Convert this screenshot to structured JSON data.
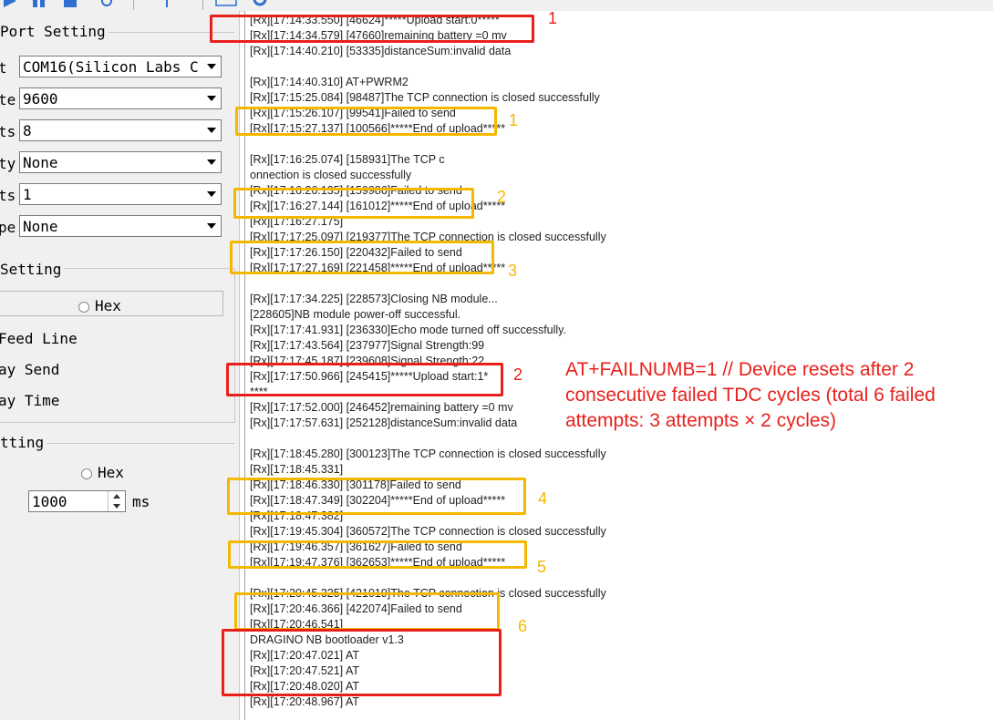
{
  "port_setting": {
    "title": "Port Setting",
    "fields": [
      {
        "label": "t",
        "value": "COM16(Silicon Labs C"
      },
      {
        "label": "te",
        "value": "9600"
      },
      {
        "label": "ts",
        "value": "8"
      },
      {
        "label": "ty",
        "value": "None"
      },
      {
        "label": "ts",
        "value": "1"
      },
      {
        "label": "pe",
        "value": "None"
      }
    ]
  },
  "receive_setting": {
    "title": " Setting",
    "hex_label": "Hex",
    "lines": [
      "Feed Line",
      "ay Send",
      "ay Time"
    ]
  },
  "send_setting": {
    "title": "tting",
    "hex_label": "Hex",
    "interval_value": "1000",
    "interval_unit": "ms"
  },
  "log_lines": [
    "[Rx][17:14:33.550] [46624]*****Upload start:0*****",
    "[Rx][17:14:34.579] [47660]remaining battery =0 mv",
    "[Rx][17:14:40.210] [53335]distanceSum:invalid data",
    "",
    "[Rx][17:14:40.310] AT+PWRM2",
    "[Rx][17:15:25.084] [98487]The TCP connection is closed successfully",
    "[Rx][17:15:26.107] [99541]Failed to send",
    "[Rx][17:15:27.137] [100566]*****End of upload*****",
    "",
    "[Rx][17:16:25.074] [158931]The TCP c",
    "onnection is closed successfully",
    "[Rx][17:16:26.135] [159986]Failed to send",
    "[Rx][17:16:27.144] [161012]*****End of upload*****",
    "[Rx][17:16:27.175]",
    "[Rx][17:17:25.097] [219377]The TCP connection is closed successfully",
    "[Rx][17:17:26.150] [220432]Failed to send",
    "[Rx][17:17:27.169] [221458]*****End of upload*****",
    "",
    "[Rx][17:17:34.225] [228573]Closing NB module...",
    "[228605]NB module power-off successful.",
    "[Rx][17:17:41.931] [236330]Echo mode turned off successfully.",
    "[Rx][17:17:43.564] [237977]Signal Strength:99",
    "[Rx][17:17:45.187] [239608]Signal Strength:22",
    "[Rx][17:17:50.966] [245415]*****Upload start:1*",
    "****",
    "[Rx][17:17:52.000] [246452]remaining battery =0 mv",
    "[Rx][17:17:57.631] [252128]distanceSum:invalid data",
    "",
    "[Rx][17:18:45.280] [300123]The TCP connection is closed successfully",
    "[Rx][17:18:45.331]",
    "[Rx][17:18:46.330] [301178]Failed to send",
    "[Rx][17:18:47.349] [302204]*****End of upload*****",
    "[Rx][17:18:47.382]",
    "[Rx][17:19:45.304] [360572]The TCP connection is closed successfully",
    "[Rx][17:19:46.357] [361627]Failed to send",
    "[Rx][17:19:47.376] [362653]*****End of upload*****",
    "",
    "[Rx][17:20:45.325] [421019]The TCP connection is closed successfully",
    "[Rx][17:20:46.366] [422074]Failed to send",
    "[Rx][17:20:46.541]",
    "DRAGINO NB bootloader v1.3",
    "[Rx][17:20:47.021] AT",
    "[Rx][17:20:47.521] AT",
    "[Rx][17:20:48.020] AT",
    "[Rx][17:20:48.967] AT"
  ],
  "annotations": {
    "red_labels": [
      "1",
      "2"
    ],
    "orange_labels": [
      "1",
      "2",
      "3",
      "4",
      "5",
      "6"
    ],
    "note": "AT+FAILNUMB=1  // Device resets after 2 consecutive failed TDC cycles (total 6 failed attempts: 3 attempts × 2 cycles)"
  },
  "colors": {
    "annotation_red": "#e8201c",
    "annotation_orange": "#f5b800",
    "toolbar_icon_blue": "#2f6fd0"
  }
}
